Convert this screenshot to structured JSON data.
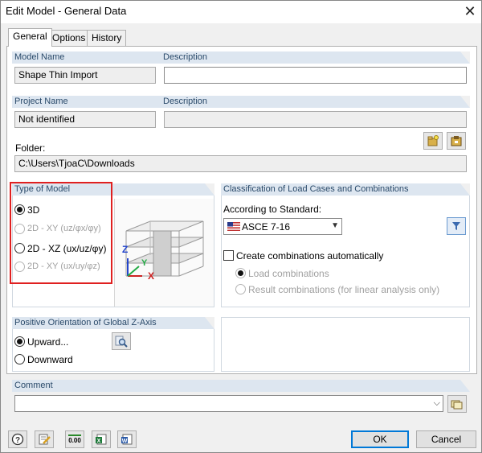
{
  "window": {
    "title": "Edit Model - General Data",
    "close_label": "✕"
  },
  "tabs": [
    {
      "label": "General"
    },
    {
      "label": "Options"
    },
    {
      "label": "History"
    }
  ],
  "model": {
    "name_header": "Model Name",
    "name_value": "Shape Thin Import",
    "description_header": "Description",
    "description_value": ""
  },
  "project": {
    "name_header": "Project Name",
    "name_value": "Not identified",
    "description_header": "Description",
    "description_value": "",
    "folder_label": "Folder:",
    "folder_value": "C:\\Users\\TjoaC\\Downloads"
  },
  "type_of_model": {
    "header": "Type of Model",
    "options": [
      {
        "label": "3D",
        "selected": true,
        "enabled": true
      },
      {
        "label": "2D - XY (uz/φx/φy)",
        "selected": false,
        "enabled": false
      },
      {
        "label": "2D - XZ (ux/uz/φy)",
        "selected": false,
        "enabled": true
      },
      {
        "label": "2D - XY (ux/uy/φz)",
        "selected": false,
        "enabled": false
      }
    ],
    "axis_labels": {
      "z": "Z",
      "y": "Y",
      "x": "X"
    }
  },
  "classification": {
    "header": "Classification of Load Cases and Combinations",
    "standard_label": "According to Standard:",
    "standard_value": "ASCE 7-16",
    "create_auto_label": "Create combinations automatically",
    "create_auto_checked": false,
    "sub_options": [
      {
        "label": "Load combinations",
        "selected": true
      },
      {
        "label": "Result combinations (for linear analysis only)",
        "selected": false
      }
    ]
  },
  "orientation": {
    "header": "Positive Orientation of Global Z-Axis",
    "options": [
      {
        "label": "Upward...",
        "selected": true
      },
      {
        "label": "Downward",
        "selected": false
      }
    ]
  },
  "comment": {
    "header": "Comment",
    "value": ""
  },
  "footer": {
    "ok_label": "OK",
    "cancel_label": "Cancel",
    "units_icon_text": "0.00"
  },
  "colors": {
    "header_bg": "#dde6f0",
    "header_text": "#2a4a6a",
    "highlight": "#e02020",
    "accent": "#0078d7"
  }
}
